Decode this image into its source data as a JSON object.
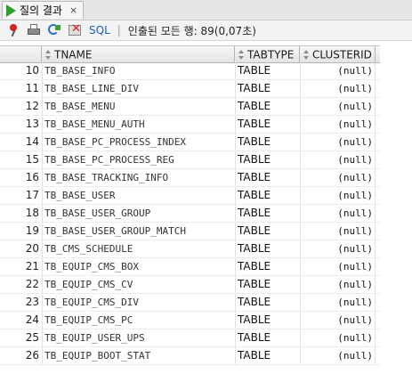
{
  "tab": {
    "title": "질의 결과",
    "close": "×"
  },
  "toolbar": {
    "sql_label": "SQL",
    "separator": "|",
    "status": "인출된 모든 행: 89(0,07초)"
  },
  "grid": {
    "columns": [
      "TNAME",
      "TABTYPE",
      "CLUSTERID"
    ],
    "rows": [
      {
        "num": "10",
        "tname": "TB_BASE_INFO",
        "tabtype": "TABLE",
        "clusterid": "(null)"
      },
      {
        "num": "11",
        "tname": "TB_BASE_LINE_DIV",
        "tabtype": "TABLE",
        "clusterid": "(null)"
      },
      {
        "num": "12",
        "tname": "TB_BASE_MENU",
        "tabtype": "TABLE",
        "clusterid": "(null)"
      },
      {
        "num": "13",
        "tname": "TB_BASE_MENU_AUTH",
        "tabtype": "TABLE",
        "clusterid": "(null)"
      },
      {
        "num": "14",
        "tname": "TB_BASE_PC_PROCESS_INDEX",
        "tabtype": "TABLE",
        "clusterid": "(null)"
      },
      {
        "num": "15",
        "tname": "TB_BASE_PC_PROCESS_REG",
        "tabtype": "TABLE",
        "clusterid": "(null)"
      },
      {
        "num": "16",
        "tname": "TB_BASE_TRACKING_INFO",
        "tabtype": "TABLE",
        "clusterid": "(null)"
      },
      {
        "num": "17",
        "tname": "TB_BASE_USER",
        "tabtype": "TABLE",
        "clusterid": "(null)"
      },
      {
        "num": "18",
        "tname": "TB_BASE_USER_GROUP",
        "tabtype": "TABLE",
        "clusterid": "(null)"
      },
      {
        "num": "19",
        "tname": "TB_BASE_USER_GROUP_MATCH",
        "tabtype": "TABLE",
        "clusterid": "(null)"
      },
      {
        "num": "20",
        "tname": "TB_CMS_SCHEDULE",
        "tabtype": "TABLE",
        "clusterid": "(null)"
      },
      {
        "num": "21",
        "tname": "TB_EQUIP_CMS_BOX",
        "tabtype": "TABLE",
        "clusterid": "(null)"
      },
      {
        "num": "22",
        "tname": "TB_EQUIP_CMS_CV",
        "tabtype": "TABLE",
        "clusterid": "(null)"
      },
      {
        "num": "23",
        "tname": "TB_EQUIP_CMS_DIV",
        "tabtype": "TABLE",
        "clusterid": "(null)"
      },
      {
        "num": "24",
        "tname": "TB_EQUIP_CMS_PC",
        "tabtype": "TABLE",
        "clusterid": "(null)"
      },
      {
        "num": "25",
        "tname": "TB_EQUIP_USER_UPS",
        "tabtype": "TABLE",
        "clusterid": "(null)"
      },
      {
        "num": "26",
        "tname": "TB_EQUIP_BOOT_STAT",
        "tabtype": "TABLE",
        "clusterid": "(null)"
      }
    ]
  }
}
